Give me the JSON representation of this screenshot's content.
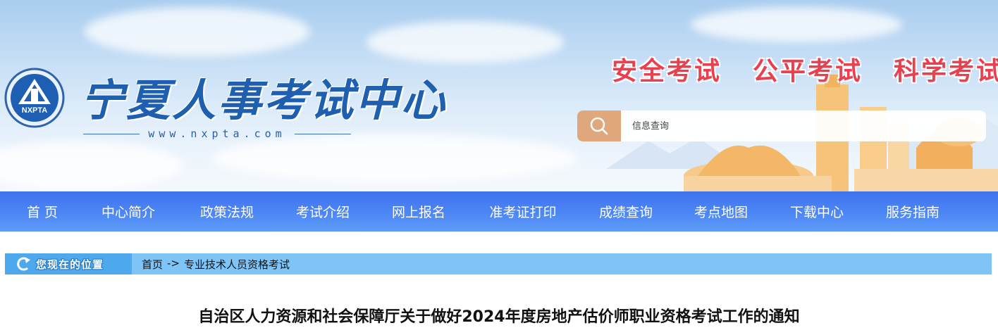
{
  "header": {
    "site_title": "宁夏人事考试中心",
    "site_url": "www.nxpta.com",
    "logo_text": "NXPTA",
    "slogans": [
      "安全考试",
      "公平考试",
      "科学考试"
    ],
    "search": {
      "placeholder": "信息查询",
      "icon": "search-icon"
    }
  },
  "nav": {
    "items": [
      {
        "label": "首  页"
      },
      {
        "label": "中心简介"
      },
      {
        "label": "政策法规"
      },
      {
        "label": "考试介绍"
      },
      {
        "label": "网上报名"
      },
      {
        "label": "准考证打印"
      },
      {
        "label": "成绩查询"
      },
      {
        "label": "考点地图"
      },
      {
        "label": "下载中心"
      },
      {
        "label": "服务指南"
      }
    ]
  },
  "breadcrumb": {
    "label": "您现在的位置",
    "items": [
      "首页",
      "专业技术人员资格考试"
    ],
    "separator": "->"
  },
  "article": {
    "title": "自治区人力资源和社会保障厅关于做好2024年度房地产估价师职业资格考试工作的通知"
  },
  "colors": {
    "nav_bg": "#4d87f5",
    "slogan": "#e8404f",
    "brand_blue": "#1f5fb0",
    "search_button": "#dfa77c",
    "breadcrumb_bg": "#7ec4f7"
  }
}
